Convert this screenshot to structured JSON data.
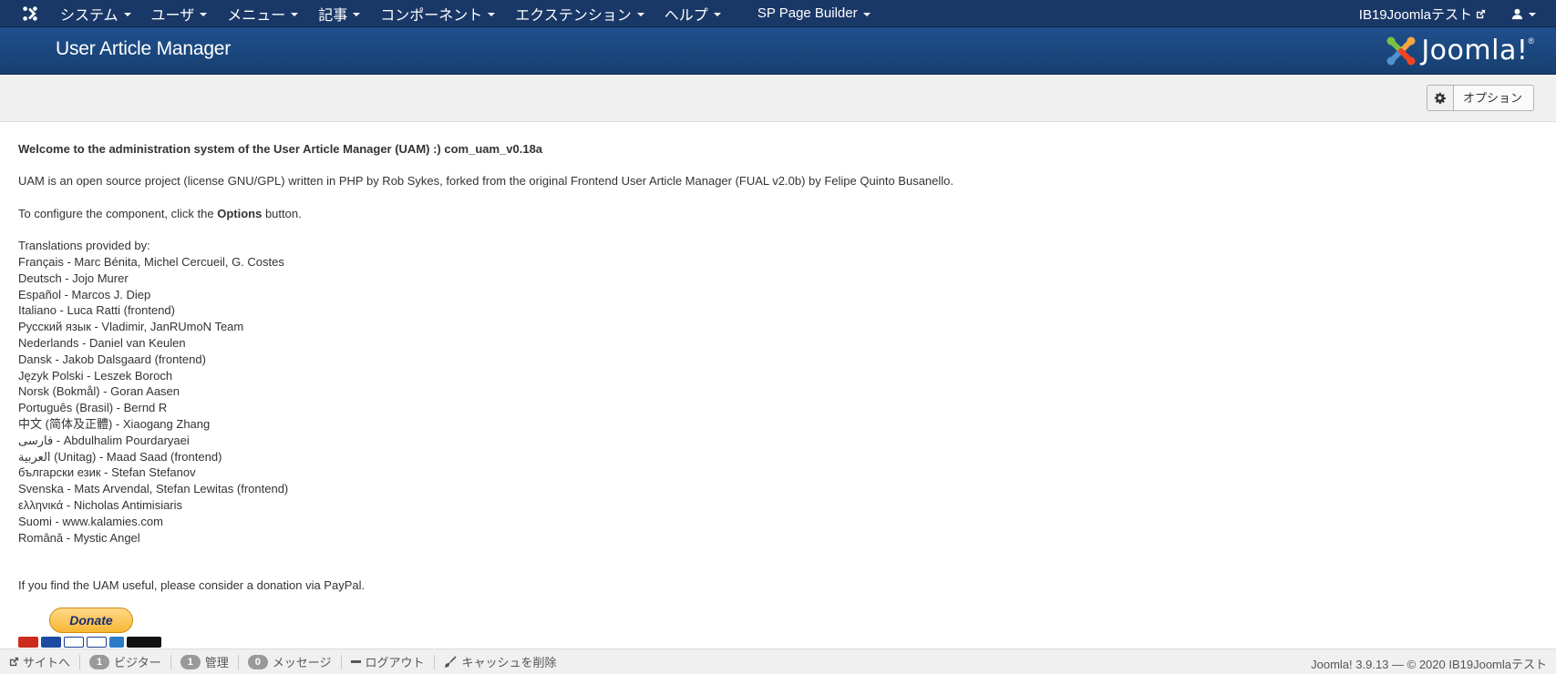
{
  "navbar": {
    "menu": [
      {
        "label": "システム"
      },
      {
        "label": "ユーザ"
      },
      {
        "label": "メニュー"
      },
      {
        "label": "記事"
      },
      {
        "label": "コンポーネント"
      },
      {
        "label": "エクステンション"
      },
      {
        "label": "ヘルプ"
      }
    ],
    "sp_page_builder": "SP Page Builder",
    "site_name": "IB19Joomlaテスト"
  },
  "header": {
    "title": "User Article Manager",
    "brand": "Joomla!",
    "brand_mark": "®"
  },
  "toolbar": {
    "options_label": "オプション"
  },
  "content": {
    "welcome": "Welcome to the administration system of the User Article Manager (UAM) :) com_uam_v0.18a",
    "about": "UAM is an open source project (license GNU/GPL) written in PHP by Rob Sykes, forked from the original Frontend User Article Manager (FUAL v2.0b) by Felipe Quinto Busanello.",
    "configure_before": "To configure the component, click the ",
    "configure_bold": "Options",
    "configure_after": " button.",
    "translations_heading": "Translations provided by:",
    "translations": [
      "Français - Marc Bénita, Michel Cercueil, G. Costes",
      "Deutsch - Jojo Murer",
      "Español - Marcos J. Diep",
      "Italiano - Luca Ratti (frontend)",
      "Русский язык - Vladimir, JanRUmoN Team",
      "Nederlands - Daniel van Keulen",
      "Dansk - Jakob Dalsgaard (frontend)",
      "Język Polski - Leszek Boroch",
      "Norsk (Bokmål) - Goran Aasen",
      "Português (Brasil) - Bernd R",
      "中文 (简体及正體) - Xiaogang Zhang",
      "فارسی - Abdulhalim Pourdaryaei",
      "العربية (Unitag) - Maad Saad (frontend)",
      "български език - Stefan Stefanov",
      "Svenska - Mats Arvendal, Stefan Lewitas (frontend)",
      "ελληνικά - Nicholas Antimisiaris",
      "Suomi - www.kalamies.com",
      "Română - Mystic Angel"
    ],
    "donation": "If you find the UAM useful, please consider a donation via PayPal.",
    "donate_button": "Donate"
  },
  "statusbar": {
    "view_site": "サイトへ",
    "visitors_count": "1",
    "visitors_label": "ビジター",
    "admins_count": "1",
    "admins_label": "管理",
    "messages_count": "0",
    "messages_label": "メッセージ",
    "logout": "ログアウト",
    "clear_cache": "キャッシュを削除",
    "copyright": "Joomla! 3.9.13 — © 2020 IB19Joomlaテスト"
  },
  "colors": {
    "navbar_bg": "#1a3867",
    "header_bg": "#1d4a86",
    "toolbar_bg": "#f0f0f0",
    "donate_gold": "#f7b733"
  }
}
